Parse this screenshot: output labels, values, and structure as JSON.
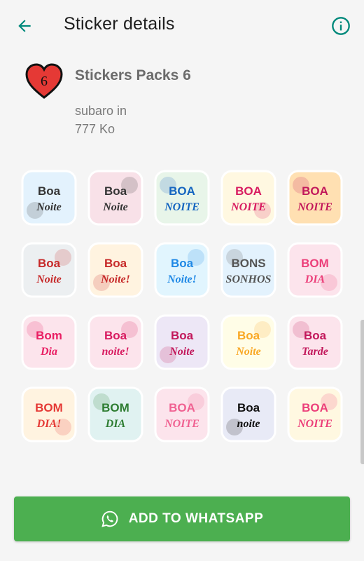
{
  "appbar": {
    "title": "Sticker details",
    "back_icon": "arrow-left-icon",
    "info_icon": "info-icon"
  },
  "pack": {
    "name": "Stickers Packs 6",
    "publisher": "subaro in",
    "size": "777 Ko",
    "icon_badge": "6"
  },
  "colors": {
    "accent": "#00897b",
    "button": "#4caf50",
    "heart": "#e53935"
  },
  "stickers": [
    {
      "t1": "Boa",
      "t2": "Noite",
      "bg": "#e3f2fd",
      "fg": "#333333",
      "theme": "cloud"
    },
    {
      "t1": "Boa",
      "t2": "Noite",
      "bg": "#f8e1e8",
      "fg": "#333333",
      "theme": "bears"
    },
    {
      "t1": "BOA",
      "t2": "NOITE",
      "bg": "#e8f5e9",
      "fg": "#1565c0",
      "theme": "fox"
    },
    {
      "t1": "BOA",
      "t2": "NOITE",
      "bg": "#fff8e1",
      "fg": "#d81b60",
      "theme": "moon"
    },
    {
      "t1": "BOA",
      "t2": "NOITE",
      "bg": "#ffe0b2",
      "fg": "#c2185b",
      "theme": "cat"
    },
    {
      "t1": "Boa",
      "t2": "Noite",
      "bg": "#eceff1",
      "fg": "#c62828",
      "theme": "sheep"
    },
    {
      "t1": "Boa",
      "t2": "Noite!",
      "bg": "#fff3e0",
      "fg": "#c62828",
      "theme": "owl"
    },
    {
      "t1": "Boa",
      "t2": "Noite!",
      "bg": "#e1f5fe",
      "fg": "#1e88e5",
      "theme": "moon2"
    },
    {
      "t1": "BONS",
      "t2": "SONHOS",
      "bg": "#e3f2fd",
      "fg": "#555555",
      "theme": "angel"
    },
    {
      "t1": "BOM",
      "t2": "DIA",
      "bg": "#fce4ec",
      "fg": "#ec407a",
      "theme": "flowers"
    },
    {
      "t1": "Bom",
      "t2": "Dia",
      "bg": "#fce4ec",
      "fg": "#e91e63",
      "theme": "girl"
    },
    {
      "t1": "Boa",
      "t2": "noite!",
      "bg": "#fce4ec",
      "fg": "#d81b60",
      "theme": "butterfly"
    },
    {
      "t1": "Boa",
      "t2": "Noite",
      "bg": "#ede7f6",
      "fg": "#c2185b",
      "theme": "window"
    },
    {
      "t1": "Boa",
      "t2": "Noite",
      "bg": "#fffde7",
      "fg": "#f9a825",
      "theme": "moonboy"
    },
    {
      "t1": "Boa",
      "t2": "Tarde",
      "bg": "#fce4ec",
      "fg": "#c2185b",
      "theme": "girl2"
    },
    {
      "t1": "BOM",
      "t2": "DIA!",
      "bg": "#fff3e0",
      "fg": "#e53935",
      "theme": "doll"
    },
    {
      "t1": "BOM",
      "t2": "DIA",
      "bg": "#e0f2f1",
      "fg": "#2e7d32",
      "theme": "snail"
    },
    {
      "t1": "BOA",
      "t2": "NOITE",
      "bg": "#fce4ec",
      "fg": "#f06292",
      "theme": "sleep"
    },
    {
      "t1": "Boa",
      "t2": "noite",
      "bg": "#e8eaf6",
      "fg": "#111111",
      "theme": "lighthouse"
    },
    {
      "t1": "BOA",
      "t2": "NOITE",
      "bg": "#fff8e1",
      "fg": "#ec407a",
      "theme": "twins"
    }
  ],
  "add_button": {
    "label": "ADD TO WHATSAPP",
    "icon": "whatsapp-icon"
  }
}
